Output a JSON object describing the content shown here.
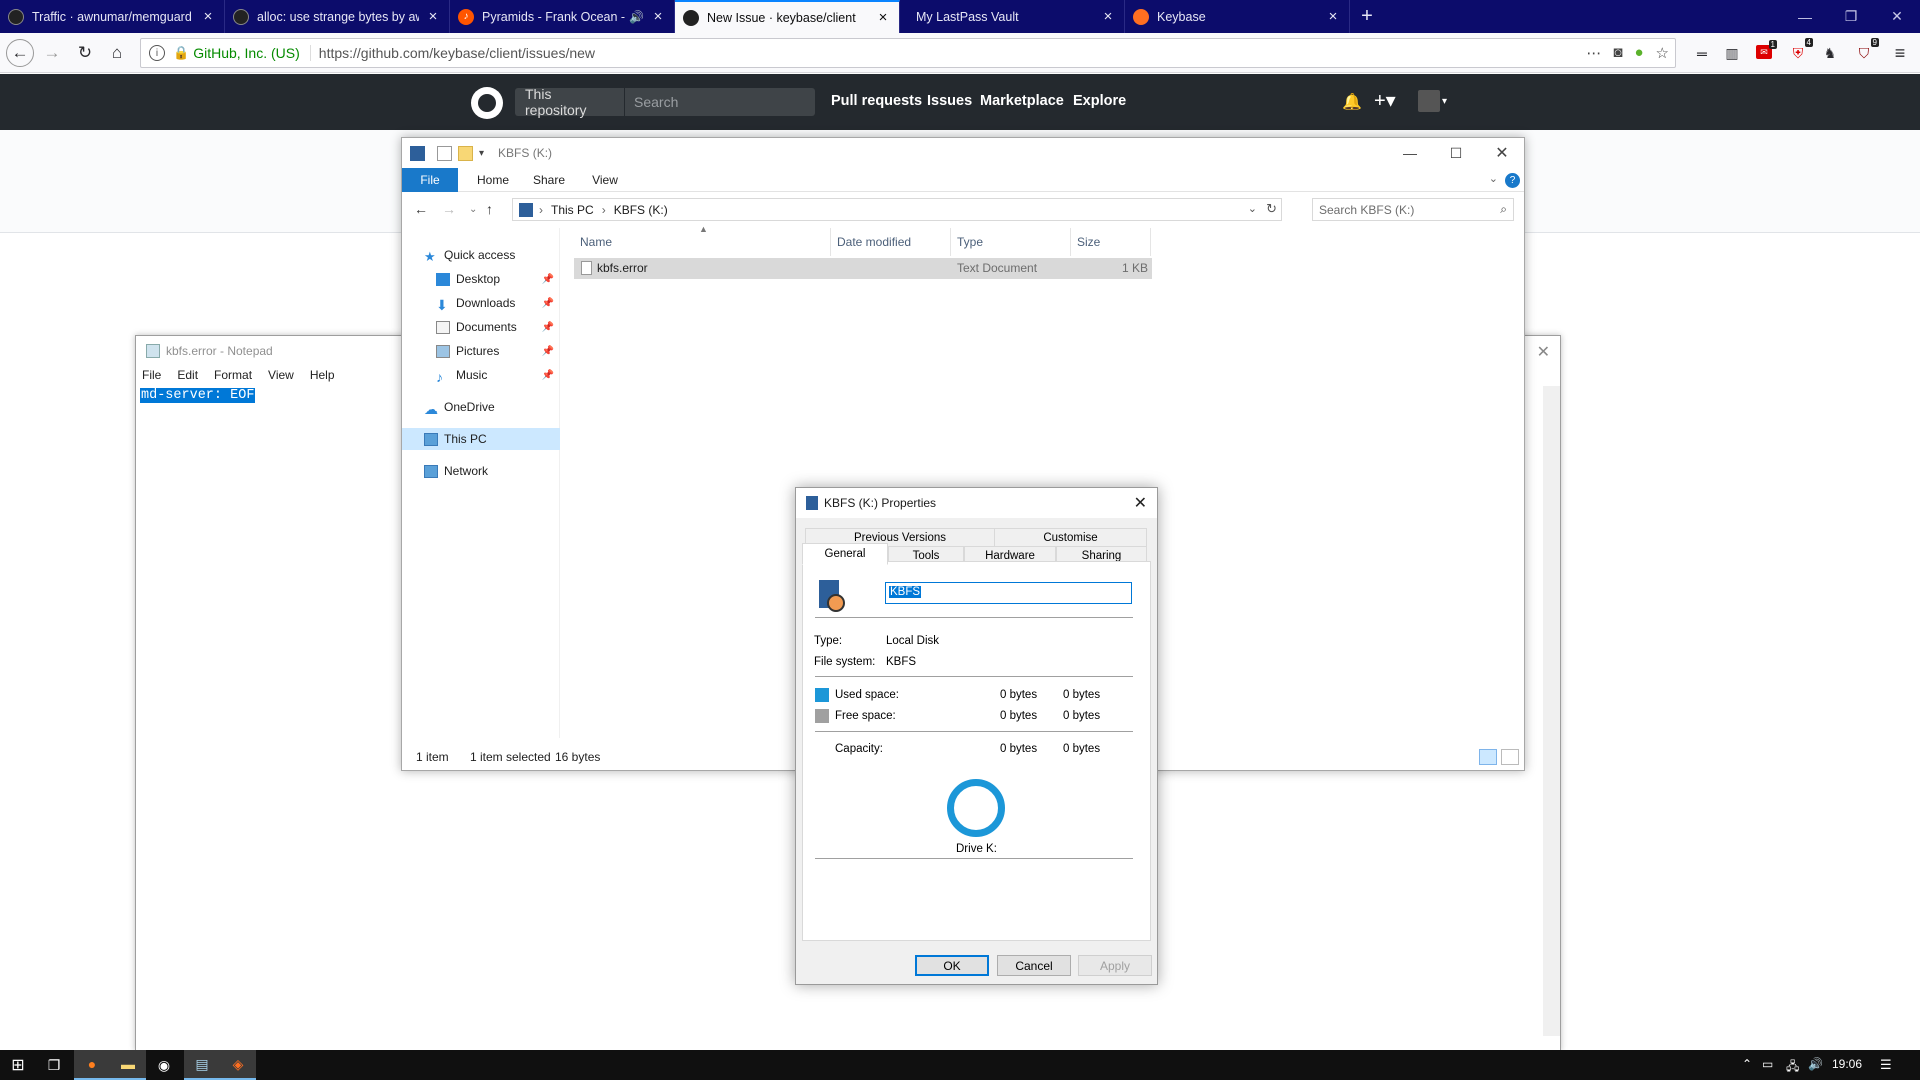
{
  "browser": {
    "tabs": [
      {
        "title": "Traffic · awnumar/memguard",
        "favicon": "github-icon"
      },
      {
        "title": "alloc: use strange bytes by awn",
        "favicon": "github-icon"
      },
      {
        "title": "Pyramids - Frank Ocean - G",
        "favicon": "music-icon"
      },
      {
        "title": "New Issue · keybase/client",
        "favicon": "github-icon",
        "active": true
      },
      {
        "title": "My LastPass Vault",
        "favicon": "lastpass-icon"
      },
      {
        "title": "Keybase",
        "favicon": "keybase-icon"
      }
    ],
    "new_tab": "+",
    "identity_org": "GitHub, Inc. (US)",
    "url": "https://github.com/keybase/client/issues/new",
    "extension_badges": {
      "b1": "1",
      "b2": "4",
      "b3": "9"
    },
    "accent_color": "#0a84ff",
    "tabstrip_color": "#0c0c6b"
  },
  "github": {
    "scope": "This repository",
    "search_placeholder": "Search",
    "nav": [
      "Pull requests",
      "Issues",
      "Marketplace",
      "Explore"
    ],
    "header_color": "#24292e"
  },
  "notepad": {
    "title": "kbfs.error - Notepad",
    "menu": [
      "File",
      "Edit",
      "Format",
      "View",
      "Help"
    ],
    "content": "md-server: EOF"
  },
  "explorer": {
    "title": "KBFS (K:)",
    "ribbon_tabs": [
      "File",
      "Home",
      "Share",
      "View"
    ],
    "help": "?",
    "path": [
      "This PC",
      "KBFS (K:)"
    ],
    "search_placeholder": "Search KBFS (K:)",
    "nav": {
      "quick_access": "Quick access",
      "pinned": [
        "Desktop",
        "Downloads",
        "Documents",
        "Pictures",
        "Music"
      ],
      "onedrive": "OneDrive",
      "this_pc": "This PC",
      "network": "Network"
    },
    "columns": [
      "Name",
      "Date modified",
      "Type",
      "Size"
    ],
    "files": [
      {
        "name": "kbfs.error",
        "date_modified": "",
        "type": "Text Document",
        "size": "1 KB"
      }
    ],
    "status": {
      "items": "1 item",
      "selected": "1 item selected",
      "size": "16 bytes"
    }
  },
  "properties": {
    "title": "KBFS (K:) Properties",
    "tabs_back": [
      "Previous Versions",
      "Customise"
    ],
    "tabs_front": [
      "General",
      "Tools",
      "Hardware",
      "Sharing"
    ],
    "drive_name": "KBFS",
    "type_label": "Type:",
    "type_value": "Local Disk",
    "fs_label": "File system:",
    "fs_value": "KBFS",
    "used_label": "Used space:",
    "used_bytes": "0 bytes",
    "used_short": "0 bytes",
    "free_label": "Free space:",
    "free_bytes": "0 bytes",
    "free_short": "0 bytes",
    "capacity_label": "Capacity:",
    "capacity_bytes": "0 bytes",
    "capacity_short": "0 bytes",
    "drive_label": "Drive K:",
    "used_color": "#1c97d8",
    "free_color": "#a0a0a0",
    "buttons": {
      "ok": "OK",
      "cancel": "Cancel",
      "apply": "Apply"
    }
  },
  "taskbar": {
    "clock": "19:06"
  }
}
